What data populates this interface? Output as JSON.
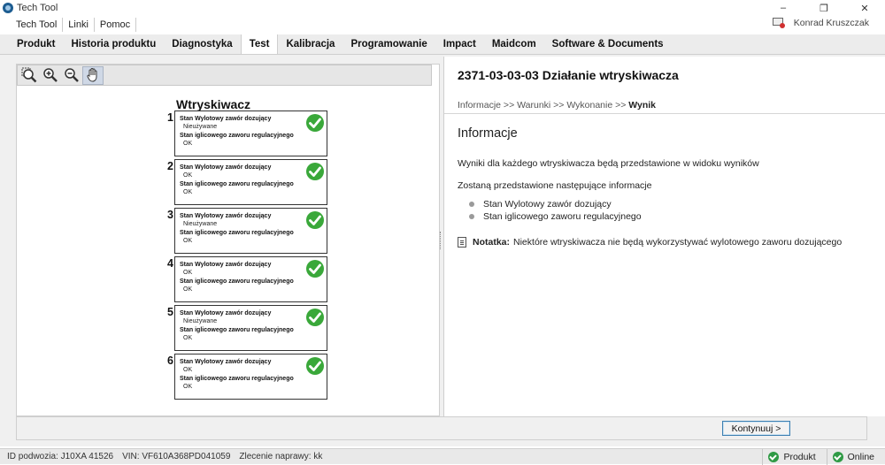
{
  "window": {
    "title": "Tech Tool",
    "app_icon": "tech-tool-icon"
  },
  "menu": {
    "items": [
      "Tech Tool",
      "Linki",
      "Pomoc"
    ]
  },
  "user": {
    "name": "Konrad Kruszczak",
    "icon": "user-status-icon"
  },
  "tabs": {
    "items": [
      "Produkt",
      "Historia produktu",
      "Diagnostyka",
      "Test",
      "Kalibracja",
      "Programowanie",
      "Impact",
      "Maidcom",
      "Software & Documents"
    ],
    "active": "Test"
  },
  "toolbar": {
    "tools": [
      {
        "name": "zoom-fit-icon",
        "pressed": false
      },
      {
        "name": "zoom-in-icon",
        "pressed": false
      },
      {
        "name": "zoom-out-icon",
        "pressed": false
      },
      {
        "name": "pan-hand-icon",
        "pressed": true
      }
    ]
  },
  "injectors": {
    "title": "Wtryskiwacz",
    "label1": "Stan Wylotowy zawór dozujący",
    "label2": "Stan iglicowego zaworu regulacyjnego",
    "items": [
      {
        "num": "1",
        "val1": "Nieużywane",
        "val2": "OK",
        "status": "ok"
      },
      {
        "num": "2",
        "val1": "OK",
        "val2": "OK",
        "status": "ok"
      },
      {
        "num": "3",
        "val1": "Nieużywane",
        "val2": "OK",
        "status": "ok"
      },
      {
        "num": "4",
        "val1": "OK",
        "val2": "OK",
        "status": "ok"
      },
      {
        "num": "5",
        "val1": "Nieużywane",
        "val2": "OK",
        "status": "ok"
      },
      {
        "num": "6",
        "val1": "OK",
        "val2": "OK",
        "status": "ok"
      }
    ]
  },
  "test": {
    "title": "2371-03-03-03 Działanie wtryskiwacza",
    "breadcrumb": {
      "path": "Informacje >> Warunki >> Wykonanie >> ",
      "current": "Wynik"
    },
    "heading": "Informacje",
    "paragraph1": "Wyniki dla każdego wtryskiwacza będą przedstawione w widoku wyników",
    "paragraph2": "Zostaną przedstawione następujące informacje",
    "bullets": [
      "Stan Wylotowy zawór dozujący",
      "Stan iglicowego zaworu regulacyjnego"
    ],
    "note_label": "Notatka:",
    "note_text": "Niektóre wtryskiwacza nie będą wykorzystywać wylotowego zaworu dozującego"
  },
  "buttons": {
    "continue": "Kontynuuj >"
  },
  "statusbar": {
    "id": "ID podwozia: J10XA 41526",
    "vin": "VIN: VF610A368PD041059",
    "order": "Zlecenie naprawy: kk",
    "product_label": "Produkt",
    "online_label": "Online",
    "status_color": "#2f9a45"
  },
  "colors": {
    "check_green": "#3aa83a",
    "accent_blue": "#3c7fb1"
  }
}
